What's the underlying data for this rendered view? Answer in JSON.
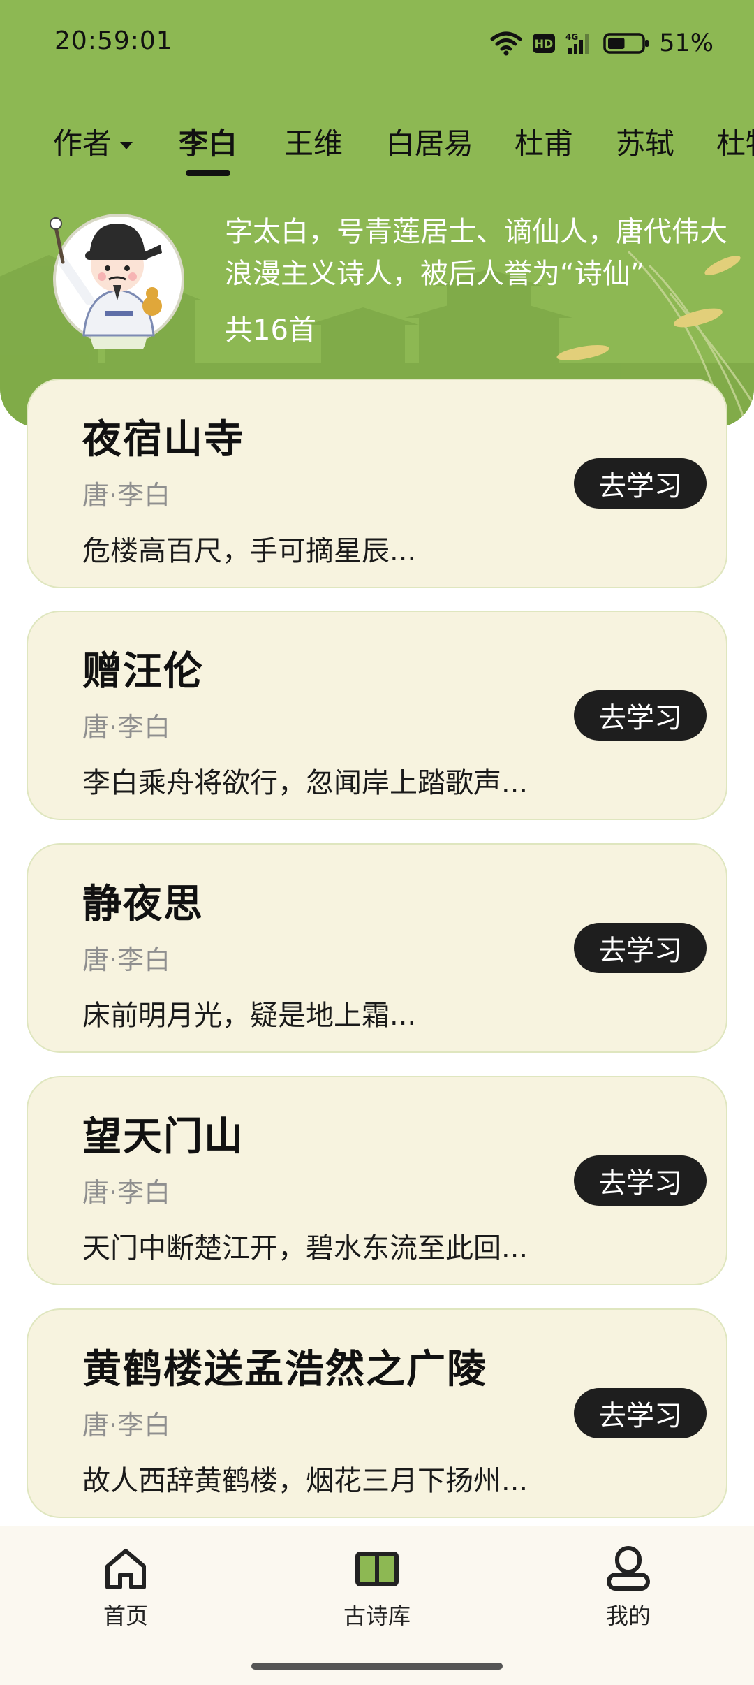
{
  "status_bar": {
    "time": "20:59:01",
    "battery_percent": "51%",
    "battery_level": 0.51,
    "icons": [
      "wifi-icon",
      "hd-icon",
      "4g-signal-icon",
      "battery-icon"
    ]
  },
  "tabs": {
    "dropdown_label": "作者",
    "items": [
      "李白",
      "王维",
      "白居易",
      "杜甫",
      "苏轼",
      "杜牧"
    ],
    "active": "李白"
  },
  "author": {
    "description": "字太白，号青莲居士、谪仙人，唐代伟大浪漫主义诗人，被后人誉为“诗仙”",
    "poem_count": "共16首"
  },
  "poems": [
    {
      "title": "夜宿山寺",
      "meta": "唐·李白",
      "first_line": "危楼高百尺，手可摘星辰...",
      "button": "去学习"
    },
    {
      "title": "赠汪伦",
      "meta": "唐·李白",
      "first_line": "李白乘舟将欲行，忽闻岸上踏歌声...",
      "button": "去学习"
    },
    {
      "title": "静夜思",
      "meta": "唐·李白",
      "first_line": "床前明月光，疑是地上霜...",
      "button": "去学习"
    },
    {
      "title": "望天门山",
      "meta": "唐·李白",
      "first_line": "天门中断楚江开，碧水东流至此回...",
      "button": "去学习"
    },
    {
      "title": "黄鹤楼送孟浩然之广陵",
      "meta": "唐·李白",
      "first_line": "故人西辞黄鹤楼，烟花三月下扬州...",
      "button": "去学习"
    }
  ],
  "bottom_nav": {
    "items": [
      {
        "label": "首页",
        "icon": "home-icon"
      },
      {
        "label": "古诗库",
        "icon": "book-icon",
        "active": true
      },
      {
        "label": "我的",
        "icon": "user-icon"
      }
    ]
  },
  "colors": {
    "header_green": "#8db853",
    "card_bg": "#f7f3df",
    "button_dark": "#1e1e1e",
    "active_nav_green": "#8db853"
  }
}
